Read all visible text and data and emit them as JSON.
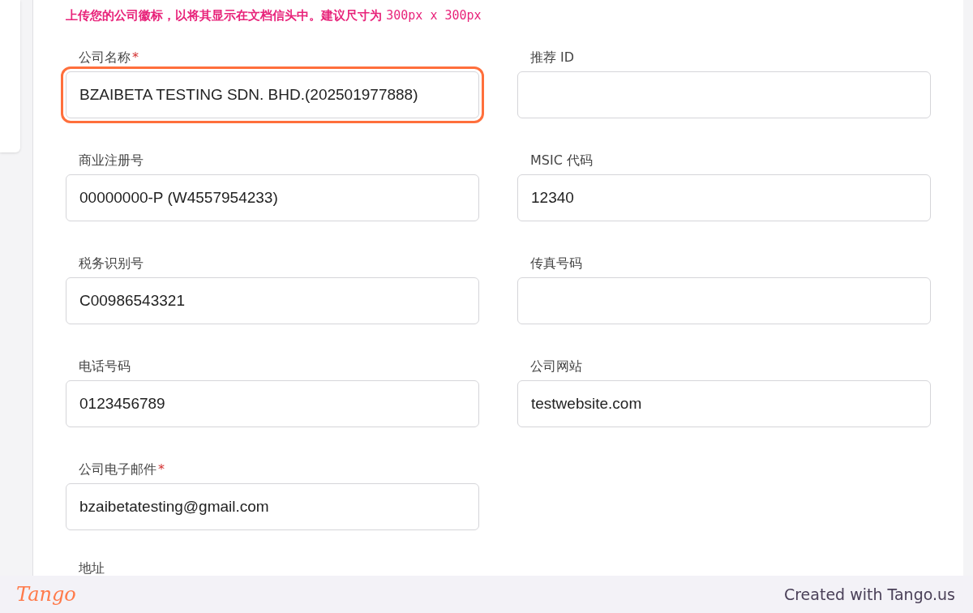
{
  "notice": {
    "text": "上传您的公司徽标，以将其显示在文档信头中。建议尺寸为",
    "size": "300px x 300px"
  },
  "fields": [
    {
      "label": "公司名称",
      "required_mark": "*",
      "value": "BZAIBETA TESTING SDN. BHD.(202501977888)",
      "highlighted": true
    },
    {
      "label": "推荐 ID",
      "highlighted": false
    },
    {
      "label": "商业注册号",
      "value": "00000000-P (W4557954233)",
      "highlighted": false
    },
    {
      "label": "MSIC 代码",
      "value": "12340",
      "highlighted": false
    },
    {
      "label": "税务识别号",
      "value": "C00986543321",
      "highlighted": false
    },
    {
      "label": "传真号码",
      "highlighted": false
    },
    {
      "label": "电话号码",
      "value": "0123456789",
      "highlighted": false
    },
    {
      "label": "公司网站",
      "value": "testwebsite.com",
      "highlighted": false
    },
    {
      "label": "公司电子邮件",
      "required_mark": "*",
      "value": "bzaibetatesting@gmail.com",
      "highlighted": false
    }
  ],
  "address_label": "地址",
  "footer": {
    "logo": "Tango",
    "credit": "Created with Tango.us"
  }
}
